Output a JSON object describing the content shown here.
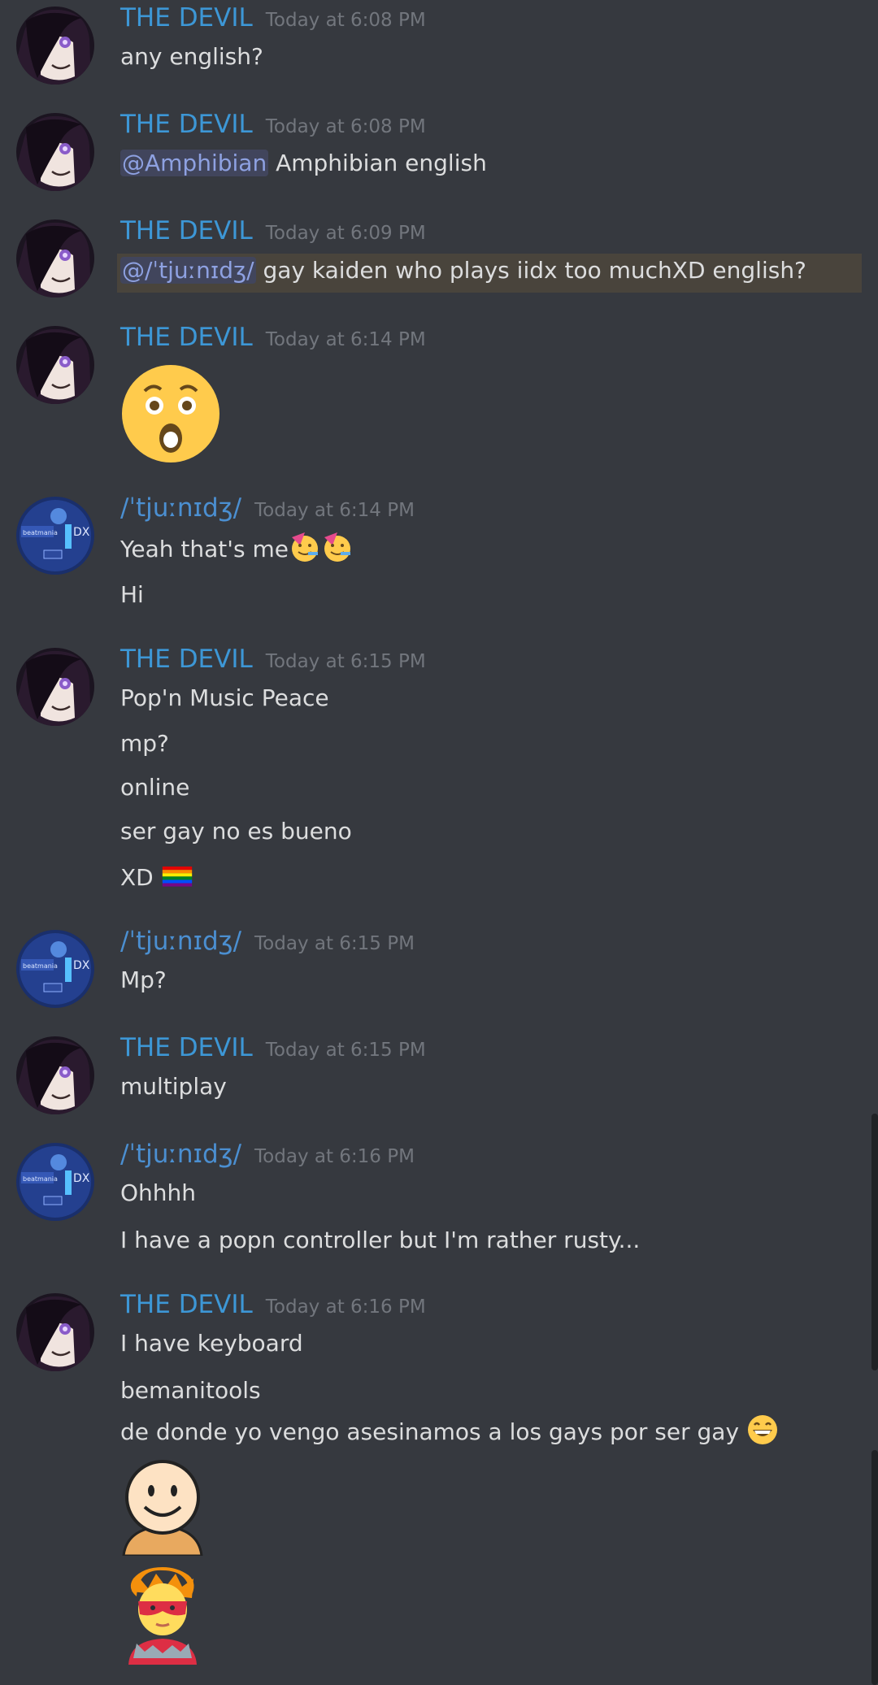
{
  "users": {
    "devil": "THE DEVIL",
    "jun": "/ˈtjuːnɪdʒ/"
  },
  "messages": [
    {
      "user": "devil",
      "time": "Today at 6:08 PM",
      "lines": [
        "any english?"
      ]
    },
    {
      "user": "devil",
      "time": "Today at 6:08 PM",
      "mention": "@Amphibian",
      "text": "Amphibian english"
    },
    {
      "user": "devil",
      "time": "Today at 6:09 PM",
      "mention": "@/ˈtjuːnɪdʒ/",
      "text": "gay kaiden who plays iidx too muchXD english?"
    },
    {
      "user": "devil",
      "time": "Today at 6:14 PM",
      "emoji": "astonished-face"
    },
    {
      "user": "jun",
      "time": "Today at 6:14 PM",
      "lines": [
        "Yeah that's me",
        "Hi"
      ],
      "inline_emoji": [
        "partying-face",
        "partying-face"
      ]
    },
    {
      "user": "devil",
      "time": "Today at 6:15 PM",
      "lines": [
        "Pop'n Music Peace",
        "mp?",
        "online",
        "ser gay no es bueno",
        "XD"
      ],
      "inline_emoji": [
        "rainbow-flag"
      ]
    },
    {
      "user": "jun",
      "time": "Today at 6:15 PM",
      "lines": [
        "Mp?"
      ]
    },
    {
      "user": "devil",
      "time": "Today at 6:15 PM",
      "lines": [
        "multiplay"
      ]
    },
    {
      "user": "jun",
      "time": "Today at 6:16 PM",
      "lines": [
        "Ohhhh",
        "I have a popn controller but I'm rather rusty..."
      ]
    },
    {
      "user": "devil",
      "time": "Today at 6:16 PM",
      "lines": [
        "I have keyboard",
        "bemanitools",
        "de donde yo vengo asesinamos a los gays por ser gay"
      ],
      "inline_emoji": [
        "grinning-face"
      ],
      "big_emoji": [
        "smiling-person-sticker",
        "superhero-emoji"
      ]
    }
  ],
  "colors": {
    "background": "#36393f",
    "username_devil": "#3d97d6",
    "username_jun": "#4b8fd1",
    "timestamp": "#72767d",
    "text": "#dcddde",
    "mention_bg": "#41455c",
    "mention_text": "#8ea1e1",
    "highlight": "#49443c"
  }
}
